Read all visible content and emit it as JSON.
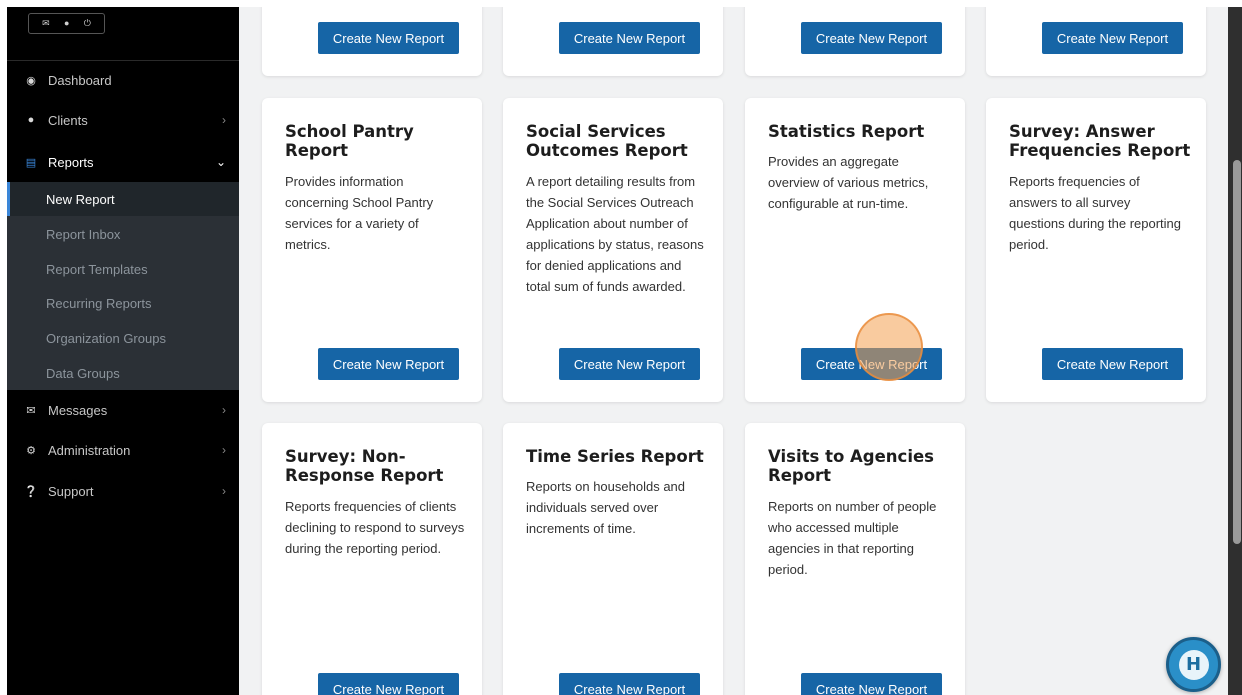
{
  "sidebar": {
    "topbar_icons": [
      "envelope-icon",
      "user-icon",
      "power-icon"
    ],
    "nav": [
      {
        "label": "Dashboard",
        "icon": "dashboard-icon"
      },
      {
        "label": "Clients",
        "icon": "user-icon"
      },
      {
        "label": "Reports",
        "icon": "bar-chart-icon"
      },
      {
        "label": "Messages",
        "icon": "envelope-icon"
      },
      {
        "label": "Administration",
        "icon": "cogs-icon"
      },
      {
        "label": "Support",
        "icon": "question-icon"
      }
    ],
    "reports_submenu": [
      "New Report",
      "Report Inbox",
      "Report Templates",
      "Recurring Reports",
      "Organization Groups",
      "Data Groups"
    ]
  },
  "cards": [
    {
      "title": "",
      "description": "",
      "button": "Create New Report"
    },
    {
      "title": "",
      "description": "",
      "button": "Create New Report"
    },
    {
      "title": "",
      "description": "",
      "button": "Create New Report"
    },
    {
      "title": "",
      "description": "",
      "button": "Create New Report"
    },
    {
      "title": "School Pantry Report",
      "description": "Provides information concerning School Pantry services for a variety of metrics.",
      "button": "Create New Report"
    },
    {
      "title": "Social Services Outcomes Report",
      "description": "A report detailing results from the Social Services Outreach Application about number of applications by status, reasons for denied applications and total sum of funds awarded.",
      "button": "Create New Report"
    },
    {
      "title": "Statistics Report",
      "description": "Provides an aggregate overview of various metrics, configurable at run-time.",
      "button": "Create New Report"
    },
    {
      "title": "Survey: Answer Frequencies Report",
      "description": "Reports frequencies of answers to all survey questions during the reporting period.",
      "button": "Create New Report"
    },
    {
      "title": "Survey: Non-Response Report",
      "description": "Reports frequencies of clients declining to respond to surveys during the reporting period.",
      "button": "Create New Report"
    },
    {
      "title": "Time Series Report",
      "description": "Reports on households and individuals served over increments of time.",
      "button": "Create New Report"
    },
    {
      "title": "Visits to Agencies Report",
      "description": "Reports on number of people who accessed multiple agencies in that reporting period.",
      "button": "Create New Report"
    }
  ],
  "colors": {
    "sidebar_bg": "#000000",
    "submenu_bg": "#2b3036",
    "accent": "#3a86d8",
    "button_bg": "#1665a6",
    "content_bg": "#f1f2f3"
  }
}
